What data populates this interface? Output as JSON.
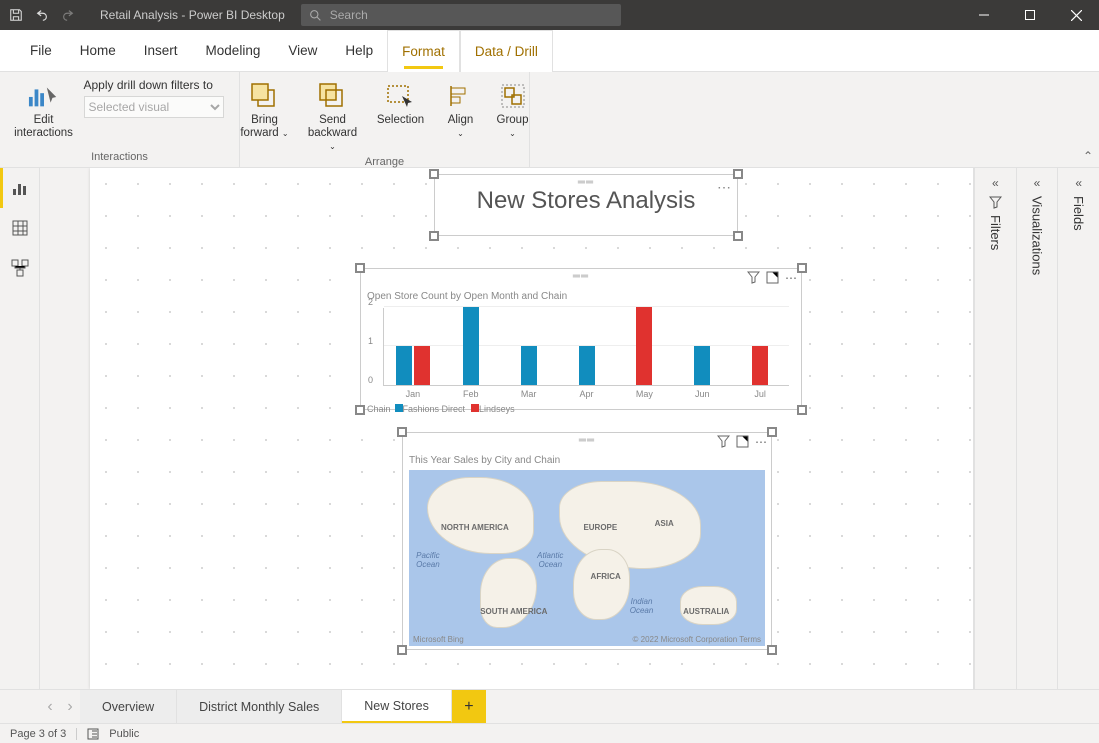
{
  "title": "Retail Analysis - Power BI Desktop",
  "search_placeholder": "Search",
  "menu": [
    "File",
    "Home",
    "Insert",
    "Modeling",
    "View",
    "Help",
    "Format",
    "Data / Drill"
  ],
  "menu_active": "Format",
  "ribbon": {
    "interactions": {
      "edit": "Edit\ninteractions",
      "apply_label": "Apply drill down filters to",
      "selected_visual": "Selected visual",
      "group": "Interactions"
    },
    "arrange": {
      "bring_forward": "Bring\nforward",
      "send_backward": "Send\nbackward",
      "selection": "Selection",
      "align": "Align",
      "group_btn": "Group",
      "group": "Arrange"
    }
  },
  "panes": {
    "filters": "Filters",
    "visualizations": "Visualizations",
    "fields": "Fields"
  },
  "page_tabs": [
    "Overview",
    "District Monthly Sales",
    "New Stores"
  ],
  "page_tabs_active": "New Stores",
  "status": {
    "page": "Page 3 of 3",
    "public": "Public"
  },
  "title_visual": "New Stores Analysis",
  "bar_visual_title": "Open Store Count by Open Month and Chain",
  "map_visual_title": "This Year Sales by City and Chain",
  "legend_label": "Chain",
  "map_attr_left": "Microsoft Bing",
  "map_attr_right": "© 2022 Microsoft Corporation  Terms",
  "map_labels": {
    "na": "NORTH AMERICA",
    "sa": "SOUTH AMERICA",
    "eu": "EUROPE",
    "af": "AFRICA",
    "as": "ASIA",
    "au": "AUSTRALIA",
    "pac": "Pacific\nOcean",
    "atl": "Atlantic\nOcean",
    "ind": "Indian\nOcean"
  },
  "chart_data": {
    "type": "bar",
    "title": "Open Store Count by Open Month and Chain",
    "ylabel": "",
    "xlabel": "",
    "ylim": [
      0,
      2
    ],
    "categories": [
      "Jan",
      "Feb",
      "Mar",
      "Apr",
      "May",
      "Jun",
      "Jul"
    ],
    "series": [
      {
        "name": "Fashions Direct",
        "color": "#118dbe",
        "values": [
          1,
          2,
          1,
          1,
          null,
          1,
          null
        ]
      },
      {
        "name": "Lindseys",
        "color": "#e0322f",
        "values": [
          1,
          null,
          null,
          null,
          2,
          null,
          1
        ]
      }
    ]
  }
}
